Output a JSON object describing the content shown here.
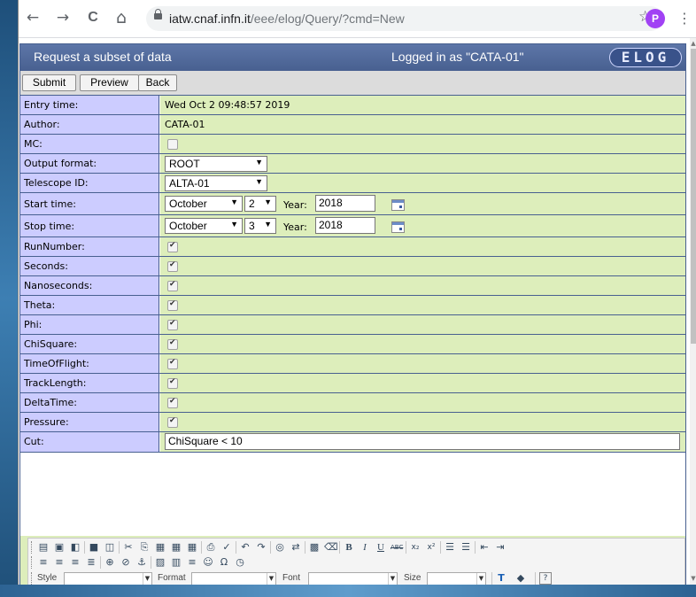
{
  "browser": {
    "url_host": "iatw.cnaf.infn.it",
    "url_path": "/eee/elog/Query/?cmd=New",
    "profile_initial": "P",
    "back_glyph": "←",
    "forward_glyph": "→",
    "reload_glyph": "C",
    "home_glyph": "⌂",
    "star_glyph": "☆",
    "menu_glyph": "⋮"
  },
  "header": {
    "title": "Request a subset of data",
    "logged_in": "Logged in as \"CATA-01\"",
    "logo": "ELOG"
  },
  "menu": {
    "submit": "Submit",
    "preview": "Preview",
    "back": "Back"
  },
  "fields": {
    "entry_time": {
      "label": "Entry time:",
      "value": "Wed Oct 2 09:48:57 2019"
    },
    "author": {
      "label": "Author:",
      "value": "CATA-01"
    },
    "mc": {
      "label": "MC:",
      "checked": false
    },
    "output_format": {
      "label": "Output format:",
      "value": "ROOT"
    },
    "telescope_id": {
      "label": "Telescope ID:",
      "value": "ALTA-01"
    },
    "start_time": {
      "label": "Start time:",
      "month": "October",
      "day": "2",
      "year_label": "Year:",
      "year": "2018"
    },
    "stop_time": {
      "label": "Stop time:",
      "month": "October",
      "day": "3",
      "year_label": "Year:",
      "year": "2018"
    },
    "checkboxes": [
      {
        "label": "RunNumber:",
        "checked": true
      },
      {
        "label": "Seconds:",
        "checked": true
      },
      {
        "label": "Nanoseconds:",
        "checked": true
      },
      {
        "label": "Theta:",
        "checked": true
      },
      {
        "label": "Phi:",
        "checked": true
      },
      {
        "label": "ChiSquare:",
        "checked": true
      },
      {
        "label": "TimeOfFlight:",
        "checked": true
      },
      {
        "label": "TrackLength:",
        "checked": true
      },
      {
        "label": "DeltaTime:",
        "checked": true
      },
      {
        "label": "Pressure:",
        "checked": true
      }
    ],
    "cut": {
      "label": "Cut:",
      "value": "ChiSquare < 10"
    }
  },
  "editor": {
    "style_label": "Style",
    "format_label": "Format",
    "font_label": "Font",
    "size_label": "Size",
    "help_glyph": "?"
  },
  "colors": {
    "header_bg": "#486090",
    "label_bg": "#ccccff",
    "value_bg": "#ddeebb",
    "menu_bg": "#dcdcdc",
    "profile_bg": "#a142f4"
  }
}
